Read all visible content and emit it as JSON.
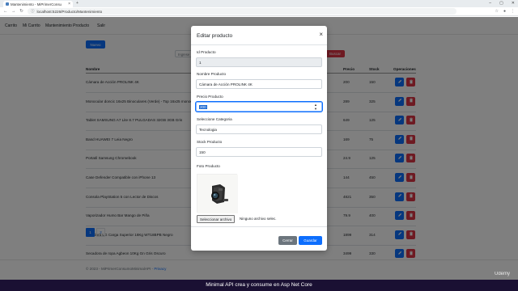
{
  "browser": {
    "tab_title": "Mantenimiento - MiPrimerConsu",
    "tab_close": "×",
    "new_tab": "+",
    "url": "localhost:5226/Producto/Mantenimiento",
    "window_controls": [
      "–",
      "▢",
      "✕"
    ]
  },
  "appnav": {
    "items": [
      "Carrito",
      "Mi Carrito",
      "Mantenimiento Producto",
      "Salir"
    ]
  },
  "page": {
    "new_button": "Nuevo",
    "search_placeholder": "Ingrese",
    "search_button": "Buscar",
    "columns": [
      "Nombre",
      "Precio",
      "Stock",
      "Operaciones"
    ],
    "rows": [
      {
        "name": "Cámara de Acción PROLINK 4K",
        "price": "200",
        "stock": "150"
      },
      {
        "name": "Monocular doncic 16x25 Binoculares (Verde) - Top 16x25 monocular",
        "price": "289",
        "stock": "325"
      },
      {
        "name": "Tablet SAMSUNG A7 Lite 8.7 PULGADAS 32GB 3GB Gris",
        "price": "649",
        "stock": "125"
      },
      {
        "name": "Band HUAWEI 7 Leia Negro",
        "price": "169",
        "stock": "75"
      },
      {
        "name": "Portatil Samsung Chromebook",
        "price": "24.9",
        "stock": "125"
      },
      {
        "name": "Case Defender Compatible con iPhone 13",
        "price": "144",
        "stock": "450"
      },
      {
        "name": "Consola PlayStation 5 con Lector de Discos",
        "price": "4821",
        "stock": "350"
      },
      {
        "name": "Vaporizador Humo Bar Mango de Piña",
        "price": "79.9",
        "stock": "400"
      },
      {
        "name": "Lavadora LG Carga Superior 18Kg WT18BPB Negro",
        "price": "1899",
        "stock": "314"
      },
      {
        "name": "Secadora de ropa Agbeon 10Kg Gn Gris Oscuro",
        "price": "3499",
        "stock": "330"
      }
    ],
    "pages": [
      "1",
      "2"
    ]
  },
  "footer": {
    "text": "© 2023 - MiPrimerConsumoMinimalAPI - ",
    "privacy": "Privacy"
  },
  "modal": {
    "title": "Editar producto",
    "close": "×",
    "id_label": "Id Producto",
    "id_value": "1",
    "name_label": "Nombre Producto",
    "name_value": "Cámara de Acción PROLINK 4K",
    "price_label": "Precio Producto",
    "price_value": "200",
    "category_label": "Seleccione Categoria",
    "category_value": "Tecnologia",
    "stock_label": "Stock Producto",
    "stock_value": "150",
    "photo_label": "Foto Producto",
    "file_button": "Seleccionar archivo",
    "file_text": "Ninguno archivo selec.",
    "close_button": "Cerrar",
    "save_button": "Guardar"
  },
  "banner": {
    "title": "Minimal API crea y consume en Asp Net Core",
    "watermark": "Udemy"
  },
  "colors": {
    "primary": "#0d6efd",
    "danger": "#dc3545",
    "secondary": "#6c757d",
    "banner": "#1a1033"
  }
}
